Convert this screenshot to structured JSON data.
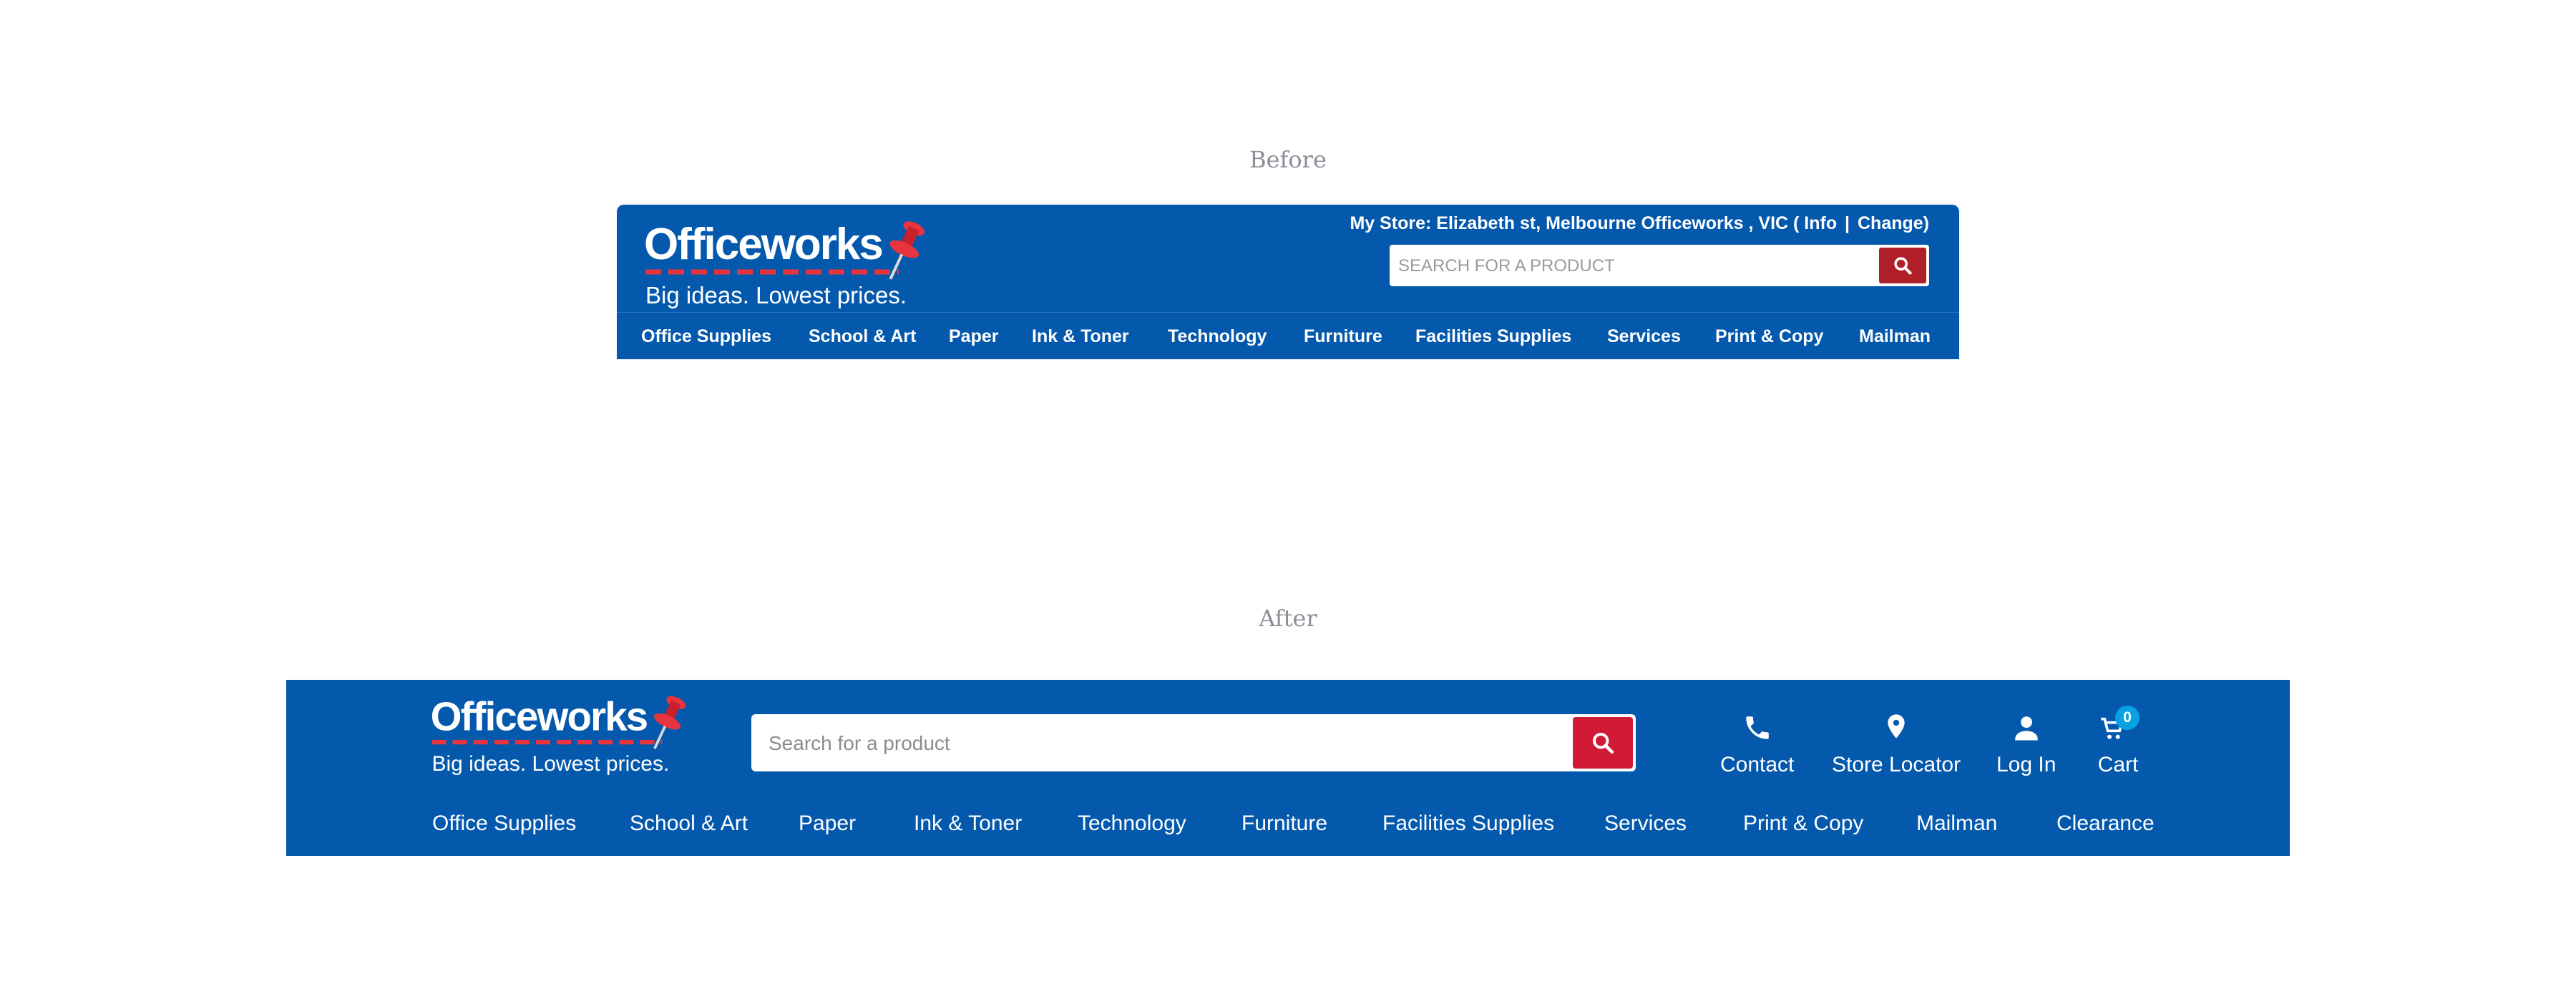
{
  "captions": {
    "before": "Before",
    "after": "After"
  },
  "brand": {
    "name": "Officeworks",
    "tagline": "Big ideas. Lowest prices.",
    "blue": "#0459ad",
    "red": "#d11a35"
  },
  "before": {
    "store_prefix": "My Store: Elizabeth st, Melbourne Officeworks , VIC ( Info",
    "store_separator": "|",
    "store_change": "Change)",
    "search_placeholder": "SEARCH FOR A PRODUCT",
    "search_icon": "search-icon",
    "nav": [
      "Office Supplies",
      "School & Art",
      "Paper",
      "Ink & Toner",
      "Technology",
      "Furniture",
      "Facilities Supplies",
      "Services",
      "Print & Copy",
      "Mailman"
    ]
  },
  "after": {
    "search_placeholder": "Search for a product",
    "search_icon": "search-icon",
    "utility": [
      {
        "label": "Contact",
        "icon": "phone-icon"
      },
      {
        "label": "Store Locator",
        "icon": "location-pin-icon"
      },
      {
        "label": "Log In",
        "icon": "user-icon"
      },
      {
        "label": "Cart",
        "icon": "cart-icon",
        "badge": "0"
      }
    ],
    "nav": [
      "Office Supplies",
      "School & Art",
      "Paper",
      "Ink & Toner",
      "Technology",
      "Furniture",
      "Facilities Supplies",
      "Services",
      "Print & Copy",
      "Mailman",
      "Clearance"
    ]
  }
}
